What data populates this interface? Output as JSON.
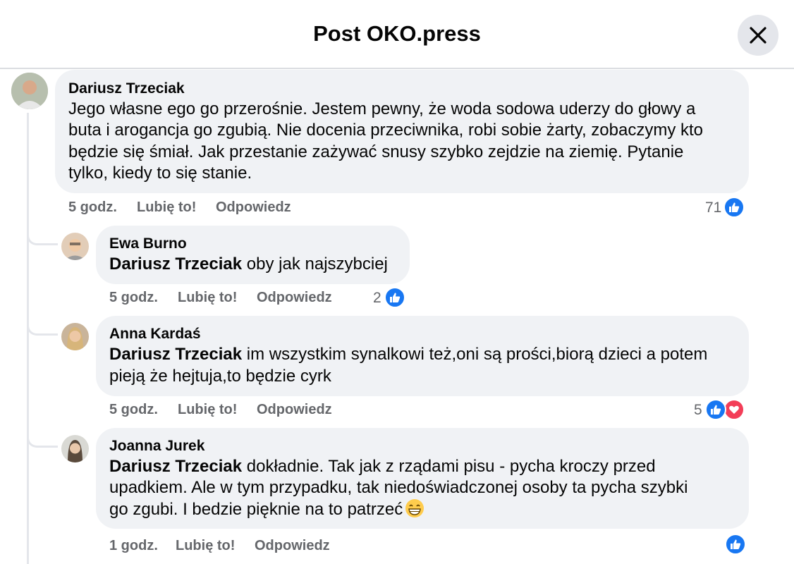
{
  "header": {
    "title": "Post OKO.press"
  },
  "comments": [
    {
      "author": "Dariusz Trzeciak",
      "lines": [
        "Jego własne ego go przerośnie. Jestem pewny, że woda sodowa uderzy do głowy a",
        "buta i arogancja go zgubią. Nie docenia przeciwnika, robi sobie żarty, zobaczymy kto",
        "będzie się śmiał. Jak przestanie zażywać snusy szybko zejdzie na ziemię. Pytanie",
        "tylko, kiedy to się stanie."
      ],
      "time": "5 godz.",
      "like": "Lubię to!",
      "reply": "Odpowiedz",
      "reactions": "71"
    },
    {
      "author": "Ewa Burno",
      "mention": "Dariusz Trzeciak",
      "lines": [
        "oby jak najszybciej"
      ],
      "time": "5 godz.",
      "like": "Lubię to!",
      "reply": "Odpowiedz",
      "reactions": "2"
    },
    {
      "author": "Anna Kardaś",
      "mention": "Dariusz Trzeciak",
      "lines": [
        "im wszystkim synalkowi też,oni są prości,biorą dzieci a potem",
        "pieją że hejtuja,to będzie cyrk"
      ],
      "time": "5 godz.",
      "like": "Lubię to!",
      "reply": "Odpowiedz",
      "reactions": "5"
    },
    {
      "author": "Joanna Jurek",
      "mention": "Dariusz Trzeciak",
      "lines": [
        "dokładnie. Tak jak z rządami pisu - pycha kroczy przed",
        "upadkiem. Ale w tym przypadku, tak niedoświadczonej osoby ta pycha szybki",
        "go zgubi. I bedzie pięknie na to patrzeć"
      ],
      "time": "1 godz.",
      "like": "Lubię to!",
      "reply": "Odpowiedz"
    }
  ],
  "colors": {
    "like": "#1877f2",
    "love": "#f33e58",
    "bubble": "#f0f2f5",
    "meta": "#65676b"
  }
}
